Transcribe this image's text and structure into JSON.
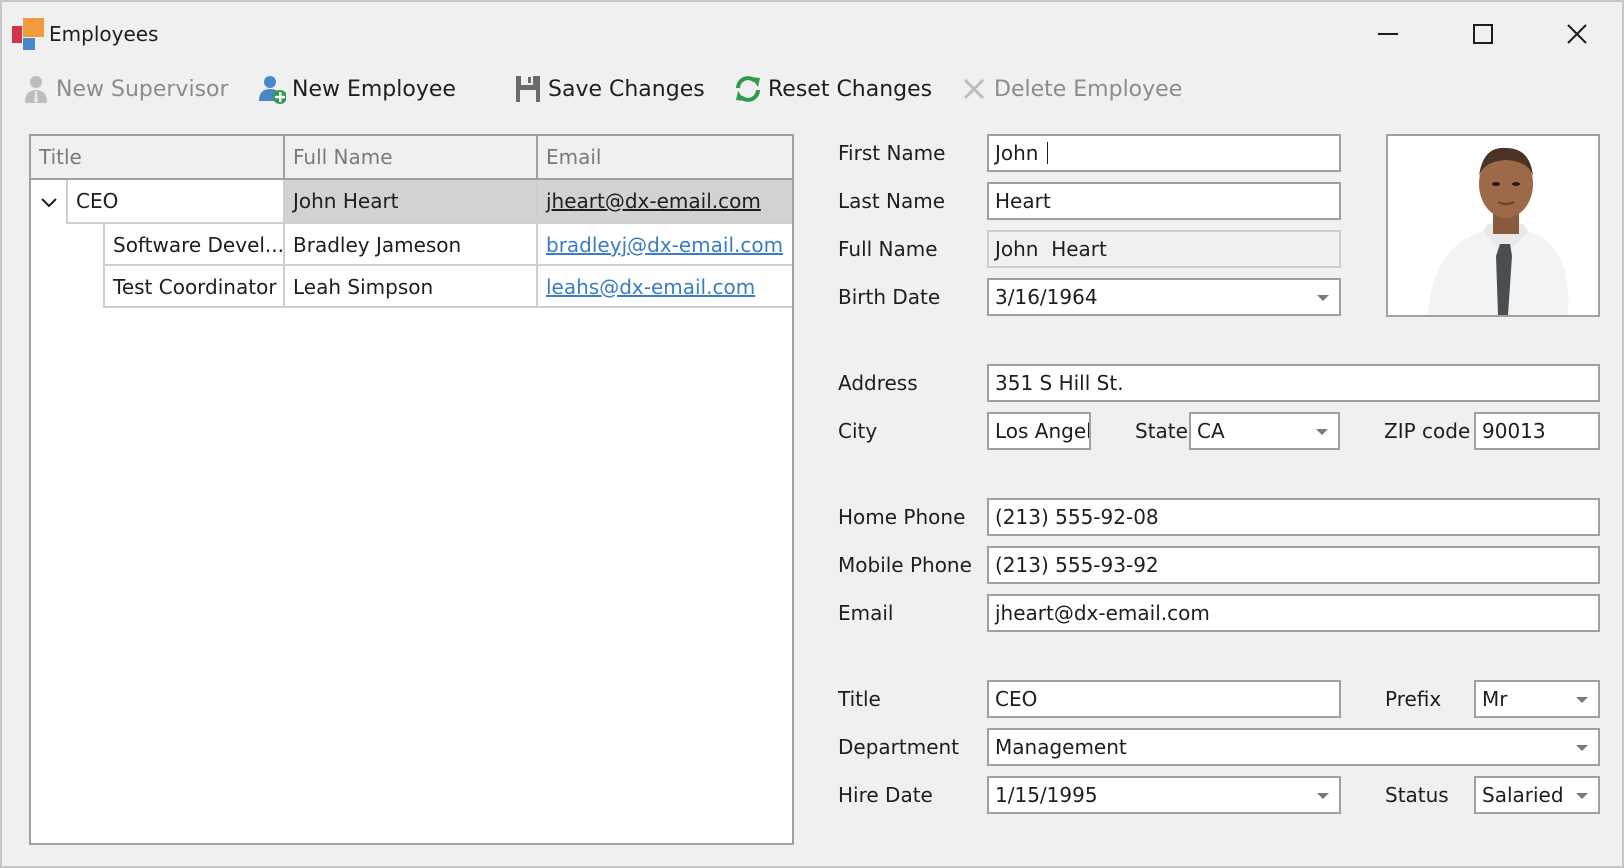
{
  "window": {
    "title": "Employees",
    "controls": [
      "minimize",
      "maximize",
      "close"
    ]
  },
  "toolbar": {
    "items": [
      {
        "label": "New Supervisor",
        "icon": "supervisor-icon",
        "enabled": false
      },
      {
        "label": "New Employee",
        "icon": "add-user-icon",
        "enabled": true
      },
      {
        "label": "Save Changes",
        "icon": "save-icon",
        "enabled": true
      },
      {
        "label": "Reset Changes",
        "icon": "refresh-icon",
        "enabled": true
      },
      {
        "label": "Delete Employee",
        "icon": "delete-icon",
        "enabled": false
      }
    ]
  },
  "grid": {
    "columns": [
      "Title",
      "Full Name",
      "Email"
    ],
    "rows": [
      {
        "title": "CEO",
        "full_name": "John Heart",
        "email": "jheart@dx-email.com",
        "level": 0,
        "expanded": true,
        "selected": true
      },
      {
        "title": "Software Devel...",
        "full_name": "Bradley Jameson",
        "email": "bradleyj@dx-email.com",
        "level": 1,
        "selected": false
      },
      {
        "title": "Test Coordinator",
        "full_name": "Leah Simpson",
        "email": "leahs@dx-email.com",
        "level": 1,
        "selected": false
      }
    ]
  },
  "form": {
    "first_name": {
      "label": "First Name",
      "value": "John"
    },
    "last_name": {
      "label": "Last Name",
      "value": "Heart"
    },
    "full_name": {
      "label": "Full Name",
      "value": "John  Heart"
    },
    "birth_date": {
      "label": "Birth Date",
      "value": "3/16/1964"
    },
    "address": {
      "label": "Address",
      "value": "351 S Hill St."
    },
    "city": {
      "label": "City",
      "value": "Los Angel"
    },
    "state": {
      "label": "State",
      "value": "CA"
    },
    "zip": {
      "label": "ZIP code",
      "value": "90013"
    },
    "home_phone": {
      "label": "Home Phone",
      "value": "(213) 555-92-08"
    },
    "mobile_phone": {
      "label": "Mobile Phone",
      "value": "(213) 555-93-92"
    },
    "email": {
      "label": "Email",
      "value": "jheart@dx-email.com"
    },
    "title": {
      "label": "Title",
      "value": "CEO"
    },
    "prefix": {
      "label": "Prefix",
      "value": "Mr"
    },
    "department": {
      "label": "Department",
      "value": "Management"
    },
    "hire_date": {
      "label": "Hire Date",
      "value": "1/15/1995"
    },
    "status": {
      "label": "Status",
      "value": "Salaried"
    }
  },
  "colors": {
    "accent_link": "#3b7dc4",
    "selected_row": "#d2d2d2",
    "refresh_green": "#2e9b4e",
    "add_green": "#2e9b4e",
    "user_blue": "#4a87c8"
  }
}
